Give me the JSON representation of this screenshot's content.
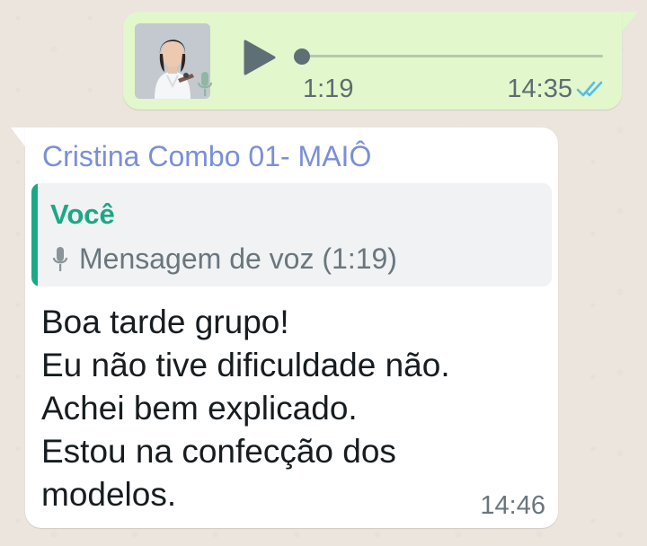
{
  "outgoing_message": {
    "type": "voice",
    "duration": "1:19",
    "time": "14:35",
    "progress": 0,
    "status": "read",
    "avatar": "sender-photo",
    "icons": {
      "play": "play-icon",
      "mic": "mic-icon",
      "status": "double-check-icon"
    }
  },
  "incoming_message": {
    "sender": "Cristina Combo 01- MAIÔ",
    "quote": {
      "author": "Você",
      "text": "Mensagem de voz (1:19)",
      "icon": "mic-icon"
    },
    "lines": [
      "Boa tarde grupo!",
      "Eu não tive dificuldade não.",
      "Achei bem explicado.",
      "Estou na confecção dos",
      "modelos."
    ],
    "time": "14:46"
  },
  "colors": {
    "outgoing_bubble": "#e2f7cb",
    "incoming_bubble": "#ffffff",
    "sender_name": "#7a8fd8",
    "quote_accent": "#1aa886",
    "read_ticks": "#53bdeb",
    "wallpaper": "#ece5dd"
  }
}
